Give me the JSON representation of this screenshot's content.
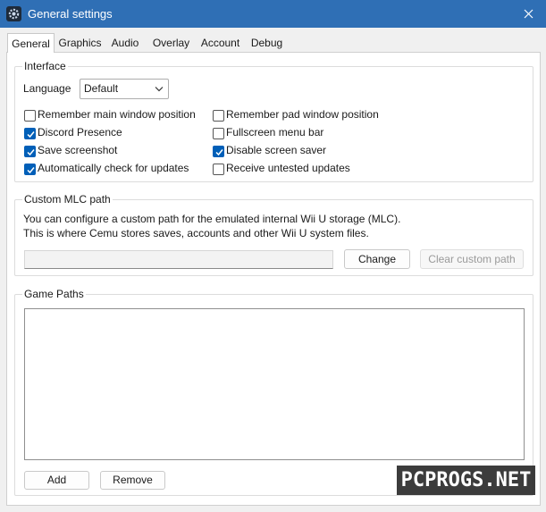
{
  "window": {
    "title": "General settings",
    "title_bar_color": "#2f6fb5",
    "accent_color": "#005fb8"
  },
  "tabs": [
    {
      "label": "General",
      "active": true
    },
    {
      "label": "Graphics",
      "active": false
    },
    {
      "label": "Audio",
      "active": false
    },
    {
      "label": "Overlay",
      "active": false
    },
    {
      "label": "Account",
      "active": false
    },
    {
      "label": "Debug",
      "active": false
    }
  ],
  "interface": {
    "title": "Interface",
    "language_label": "Language",
    "language_value": "Default",
    "checkboxes": [
      {
        "label": "Remember main window position",
        "checked": false
      },
      {
        "label": "Remember pad window position",
        "checked": false
      },
      {
        "label": "Discord Presence",
        "checked": true
      },
      {
        "label": "Fullscreen menu bar",
        "checked": false
      },
      {
        "label": "Save screenshot",
        "checked": true
      },
      {
        "label": "Disable screen saver",
        "checked": true
      },
      {
        "label": "Automatically check for updates",
        "checked": true
      },
      {
        "label": "Receive untested updates",
        "checked": false
      }
    ]
  },
  "mlc": {
    "title": "Custom MLC path",
    "description_line1": "You can configure a custom path for the emulated internal Wii U storage (MLC).",
    "description_line2": "This is where Cemu stores saves, accounts and other Wii U system files.",
    "path_value": "",
    "change_label": "Change",
    "clear_label": "Clear custom path"
  },
  "game_paths": {
    "title": "Game Paths",
    "items": [],
    "add_label": "Add",
    "remove_label": "Remove"
  },
  "watermark": {
    "text": "PCPROGS.NET"
  }
}
